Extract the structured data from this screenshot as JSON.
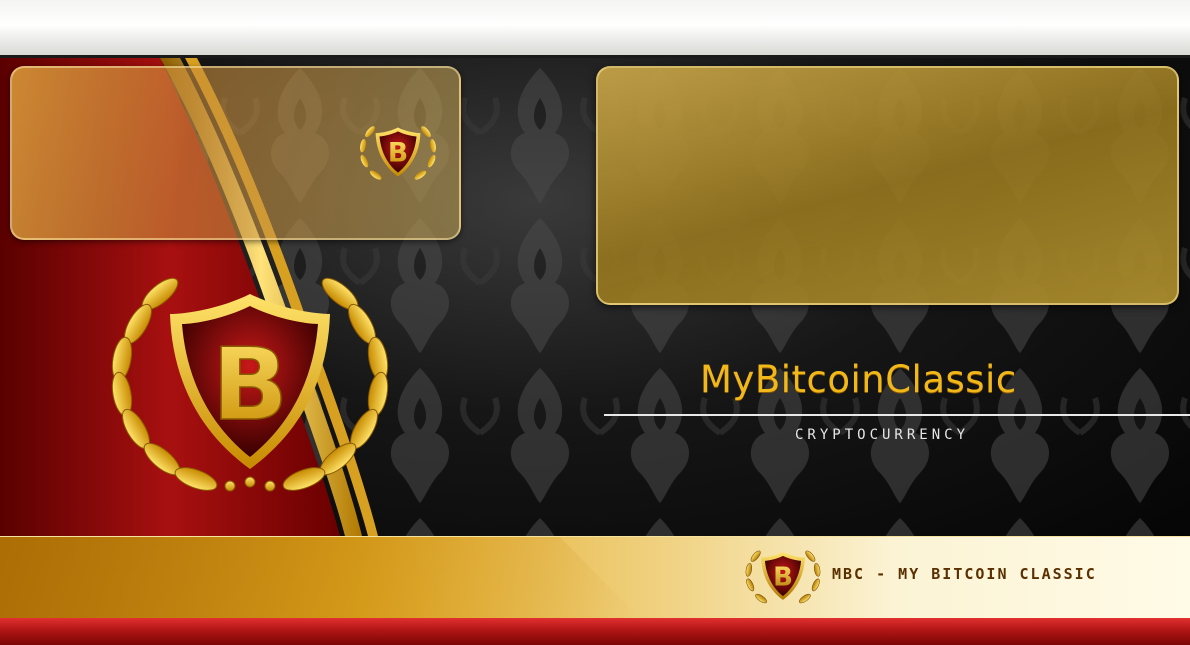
{
  "brand": {
    "title": "MyBitcoinClassic",
    "subtitle": "CRYPTOCURRENCY",
    "footer_label": "MBC - MY BITCOIN CLASSIC",
    "logo_letter": "B"
  },
  "colors": {
    "gold": "#f2b81a",
    "deep_red": "#8b0a0a",
    "background": "#0a0a0a",
    "panel_gold": "#b8962e"
  },
  "icons": {
    "large_emblem": "laurel-shield-b-emblem",
    "small_emblem": "laurel-shield-b-emblem",
    "footer_emblem": "laurel-shield-b-emblem"
  }
}
